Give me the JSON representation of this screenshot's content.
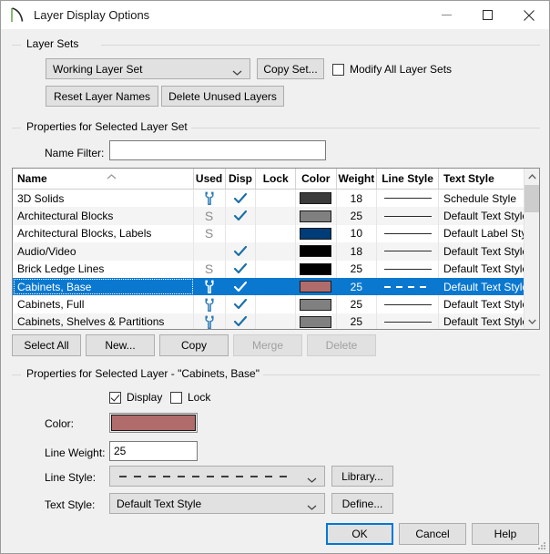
{
  "window": {
    "title": "Layer Display Options",
    "icon": "app-arc-icon",
    "minimize": "minimize-icon",
    "maximize": "maximize-icon",
    "close": "close-icon"
  },
  "layer_sets": {
    "group_label": "Layer Sets",
    "combo_value": "Working Layer Set",
    "copy_set_label": "Copy Set...",
    "modify_all_label": "Modify All Layer Sets",
    "modify_all_checked": false,
    "reset_label": "Reset Layer Names",
    "delete_unused_label": "Delete Unused Layers"
  },
  "selected_set": {
    "group_label": "Properties for Selected Layer Set",
    "name_filter_label": "Name Filter:",
    "name_filter_value": "",
    "name_filter_placeholder": ""
  },
  "table": {
    "columns": [
      "Name",
      "Used",
      "Disp",
      "Lock",
      "Color",
      "Weight",
      "Line Style",
      "Text Style"
    ],
    "sort_column": "Name",
    "sort_direction": "ascending",
    "rows": [
      {
        "name": "3D Solids",
        "used": "wrench",
        "disp": true,
        "lock": false,
        "color": "#3a3a3a",
        "weight": "18",
        "line_style": "solid",
        "text_style": "Schedule Style",
        "selected": false
      },
      {
        "name": "Architectural Blocks",
        "used": "S",
        "disp": true,
        "lock": false,
        "color": "#808080",
        "weight": "25",
        "line_style": "solid",
        "text_style": "Default Text Style",
        "selected": false
      },
      {
        "name": "Architectural Blocks, Labels",
        "used": "S",
        "disp": false,
        "lock": false,
        "color": "#003c78",
        "weight": "10",
        "line_style": "solid",
        "text_style": "Default Label Style",
        "selected": false
      },
      {
        "name": "Audio/Video",
        "used": "",
        "disp": true,
        "lock": false,
        "color": "#000000",
        "weight": "18",
        "line_style": "solid",
        "text_style": "Default Text Style",
        "selected": false
      },
      {
        "name": "Brick Ledge Lines",
        "used": "S",
        "disp": true,
        "lock": false,
        "color": "#000000",
        "weight": "25",
        "line_style": "solid",
        "text_style": "Default Text Style",
        "selected": false
      },
      {
        "name": "Cabinets,  Base",
        "used": "wrench",
        "disp": true,
        "lock": false,
        "color": "#b06b6b",
        "weight": "25",
        "line_style": "dashed",
        "text_style": "Default Text Style",
        "selected": true
      },
      {
        "name": "Cabinets,  Full",
        "used": "wrench",
        "disp": true,
        "lock": false,
        "color": "#808080",
        "weight": "25",
        "line_style": "solid",
        "text_style": "Default Text Style",
        "selected": false
      },
      {
        "name": "Cabinets,  Shelves & Partitions",
        "used": "wrench",
        "disp": true,
        "lock": false,
        "color": "#808080",
        "weight": "25",
        "line_style": "solid",
        "text_style": "Default Text Style",
        "selected": false
      }
    ]
  },
  "table_buttons": {
    "select_all": "Select All",
    "new": "New...",
    "copy": "Copy",
    "merge": "Merge",
    "merge_disabled": true,
    "delete": "Delete",
    "delete_disabled": true
  },
  "selected_layer": {
    "group_label": "Properties for Selected Layer - \"Cabinets,  Base\"",
    "display_label": "Display",
    "display_checked": true,
    "lock_label": "Lock",
    "lock_checked": false,
    "color_label": "Color:",
    "color_value": "#b06b6b",
    "line_weight_label": "Line Weight:",
    "line_weight_value": "25",
    "line_style_label": "Line Style:",
    "line_style_value": "dashed",
    "library_label": "Library...",
    "text_style_label": "Text Style:",
    "text_style_value": "Default Text Style",
    "define_label": "Define..."
  },
  "footer": {
    "ok": "OK",
    "cancel": "Cancel",
    "help": "Help"
  },
  "theme": {
    "accent": "#0078d7",
    "selection": "#0b78d0",
    "dialog_bg": "#f0f0f0"
  }
}
